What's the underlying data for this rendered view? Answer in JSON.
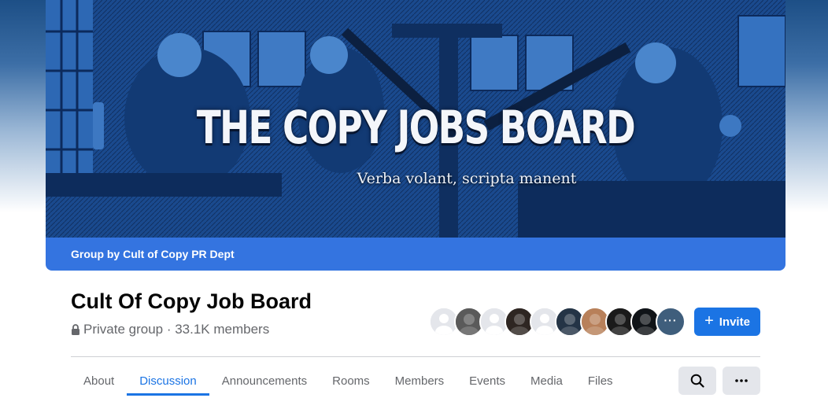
{
  "cover": {
    "title": "THE COPY JOBS BOARD",
    "motto": "Verba volant, scripta manent"
  },
  "owner_bar": {
    "text": "Group by Cult of Copy PR Dept"
  },
  "group": {
    "name": "Cult Of Copy Job Board",
    "meta": "Private group · 33.1K members"
  },
  "member_avatars": [
    {
      "type": "placeholder",
      "color": "#d8dadf"
    },
    {
      "type": "photo",
      "color": "#5a5a5a"
    },
    {
      "type": "placeholder",
      "color": "#d8dadf"
    },
    {
      "type": "photo",
      "color": "#2e2622"
    },
    {
      "type": "placeholder",
      "color": "#d8dadf"
    },
    {
      "type": "photo",
      "color": "#243446"
    },
    {
      "type": "photo",
      "color": "#b8805a"
    },
    {
      "type": "photo",
      "color": "#1a1a1a"
    },
    {
      "type": "photo",
      "color": "#101418"
    },
    {
      "type": "more",
      "color": "#3f5e7c"
    }
  ],
  "more_avatars_label": "···",
  "invite_button": {
    "icon": "plus-icon",
    "label": "Invite"
  },
  "tabs": [
    {
      "label": "About",
      "active": false
    },
    {
      "label": "Discussion",
      "active": true
    },
    {
      "label": "Announcements",
      "active": false
    },
    {
      "label": "Rooms",
      "active": false
    },
    {
      "label": "Members",
      "active": false
    },
    {
      "label": "Events",
      "active": false
    },
    {
      "label": "Media",
      "active": false
    },
    {
      "label": "Files",
      "active": false
    }
  ],
  "toolbar": {
    "search_icon": "search-icon",
    "more_icon": "more-icon"
  },
  "colors": {
    "accent": "#1b74e4",
    "owner_bar": "#3474e0",
    "secondary_text": "#65676b",
    "cover_blue": "#0c2a5c"
  }
}
